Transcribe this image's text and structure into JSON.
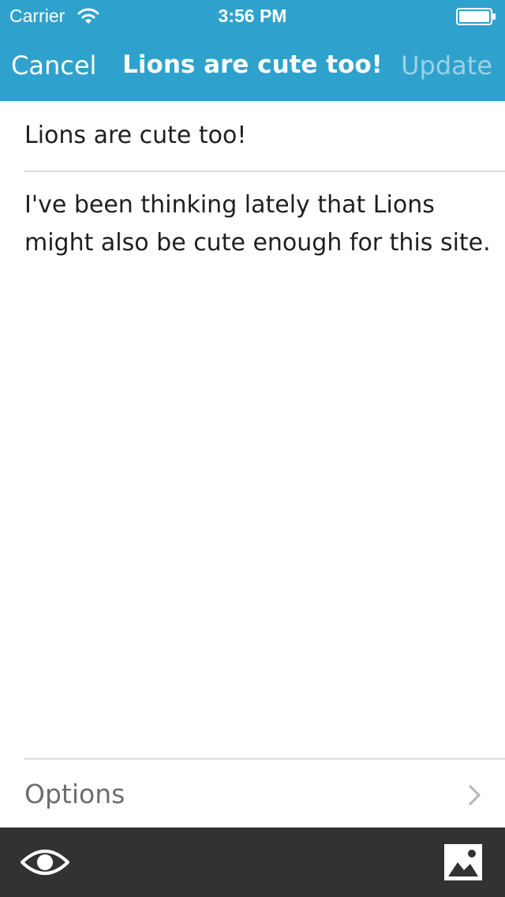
{
  "status_bar": {
    "carrier": "Carrier",
    "time": "3:56 PM",
    "wifi_icon": "wifi-icon",
    "battery_icon": "battery-icon"
  },
  "nav_bar": {
    "cancel_label": "Cancel",
    "title": "Lions are cute too!",
    "update_label": "Update"
  },
  "editor": {
    "title_value": "Lions are cute too!",
    "content_value": "I've been thinking lately that Lions might also be cute enough for this site."
  },
  "options": {
    "label": "Options",
    "icon": "chevron-right-icon"
  },
  "toolbar": {
    "preview_icon": "eye-icon",
    "media_icon": "image-icon"
  },
  "colors": {
    "nav_background": "#2ea2cc",
    "nav_text": "#ffffff",
    "update_disabled_text": "#9ed0e6",
    "toolbar_background": "#323232",
    "options_text": "#6d6d6d",
    "body_text": "#1f1f1f"
  }
}
